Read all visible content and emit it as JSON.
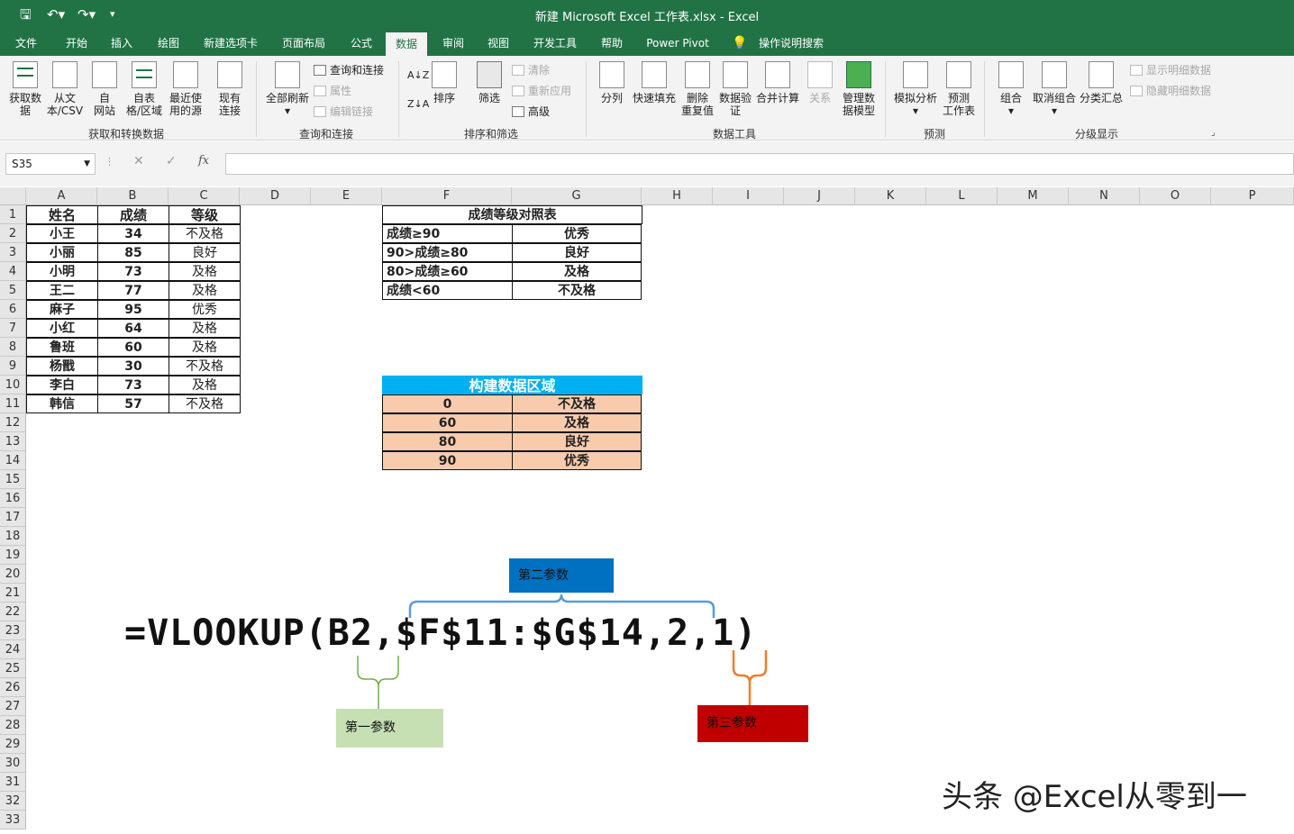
{
  "window": {
    "title": "新建 Microsoft Excel 工作表.xlsx  -  Excel"
  },
  "tabs": [
    "文件",
    "开始",
    "插入",
    "绘图",
    "新建选项卡",
    "页面布局",
    "公式",
    "数据",
    "审阅",
    "视图",
    "开发工具",
    "帮助",
    "Power Pivot",
    "操作说明搜索"
  ],
  "active_tab": "数据",
  "ribbon": {
    "get_data": {
      "buttons": [
        "获取数\n据",
        "从文\n本/CSV",
        "自\n网站",
        "自表\n格/区域",
        "最近使\n用的源",
        "现有\n连接"
      ],
      "group": "获取和转换数据"
    },
    "queries": {
      "refresh": "全部刷新",
      "items": [
        "查询和连接",
        "属性",
        "编辑链接"
      ],
      "group": "查询和连接"
    },
    "sort": {
      "az": "A↓Z",
      "za": "Z↓A",
      "sort": "排序",
      "filter": "筛选",
      "items": [
        "清除",
        "重新应用",
        "高级"
      ],
      "group": "排序和筛选"
    },
    "tools": {
      "buttons": [
        "分列",
        "快速填充",
        "删除\n重复值",
        "数据验\n证",
        "合并计算",
        "关系",
        "管理数\n据模型"
      ],
      "group": "数据工具"
    },
    "forecast": {
      "buttons": [
        "模拟分析",
        "预测\n工作表"
      ],
      "group": "预测"
    },
    "outline": {
      "buttons": [
        "组合",
        "取消组合",
        "分类汇总"
      ],
      "items": [
        "显示明细数据",
        "隐藏明细数据"
      ],
      "group": "分级显示"
    }
  },
  "formula_bar": {
    "name_box": "S35",
    "cancel": "✕",
    "enter": "✓",
    "fx": "fx",
    "value": ""
  },
  "columns": [
    "A",
    "B",
    "C",
    "D",
    "E",
    "F",
    "G",
    "H",
    "I",
    "J",
    "K",
    "L",
    "M",
    "N",
    "O",
    "P"
  ],
  "rows": [
    "1",
    "2",
    "3",
    "4",
    "5",
    "6",
    "7",
    "8",
    "9",
    "10",
    "11",
    "12",
    "13",
    "14",
    "15",
    "16",
    "17",
    "18",
    "19",
    "20",
    "21",
    "22",
    "23",
    "24",
    "25",
    "26",
    "27",
    "28",
    "29",
    "30",
    "31",
    "32",
    "33"
  ],
  "table1": {
    "headers": [
      "姓名",
      "成绩",
      "等级"
    ],
    "rows": [
      [
        "小王",
        "34",
        "不及格"
      ],
      [
        "小丽",
        "85",
        "良好"
      ],
      [
        "小明",
        "73",
        "及格"
      ],
      [
        "王二",
        "77",
        "及格"
      ],
      [
        "麻子",
        "95",
        "优秀"
      ],
      [
        "小红",
        "64",
        "及格"
      ],
      [
        "鲁班",
        "60",
        "及格"
      ],
      [
        "杨戬",
        "30",
        "不及格"
      ],
      [
        "李白",
        "73",
        "及格"
      ],
      [
        "韩信",
        "57",
        "不及格"
      ]
    ]
  },
  "table2": {
    "title": "成绩等级对照表",
    "rows": [
      [
        "成绩≥90",
        "优秀"
      ],
      [
        "90>成绩≥80",
        "良好"
      ],
      [
        "80>成绩≥60",
        "及格"
      ],
      [
        "成绩<60",
        "不及格"
      ]
    ]
  },
  "table3": {
    "title": "构建数据区域",
    "rows": [
      [
        "0",
        "不及格"
      ],
      [
        "60",
        "及格"
      ],
      [
        "80",
        "良好"
      ],
      [
        "90",
        "优秀"
      ]
    ]
  },
  "formula": {
    "text": "=VLOOKUP(B2,$F$11:$G$14,2,1)"
  },
  "annotations": {
    "param1": "第一参数",
    "param2": "第二参数",
    "param3": "第三参数"
  },
  "colors": {
    "excel_green": "#217346",
    "param1_bg": "#c6e0b4",
    "param2_bg": "#0070c0",
    "param3_bg": "#c00000",
    "table3_header": "#00b0f0",
    "table3_body": "#f8cbad",
    "brace_blue": "#5b9bd5",
    "brace_green": "#70ad47",
    "brace_orange": "#ed7d31"
  },
  "watermark": "头条 @Excel从零到一"
}
